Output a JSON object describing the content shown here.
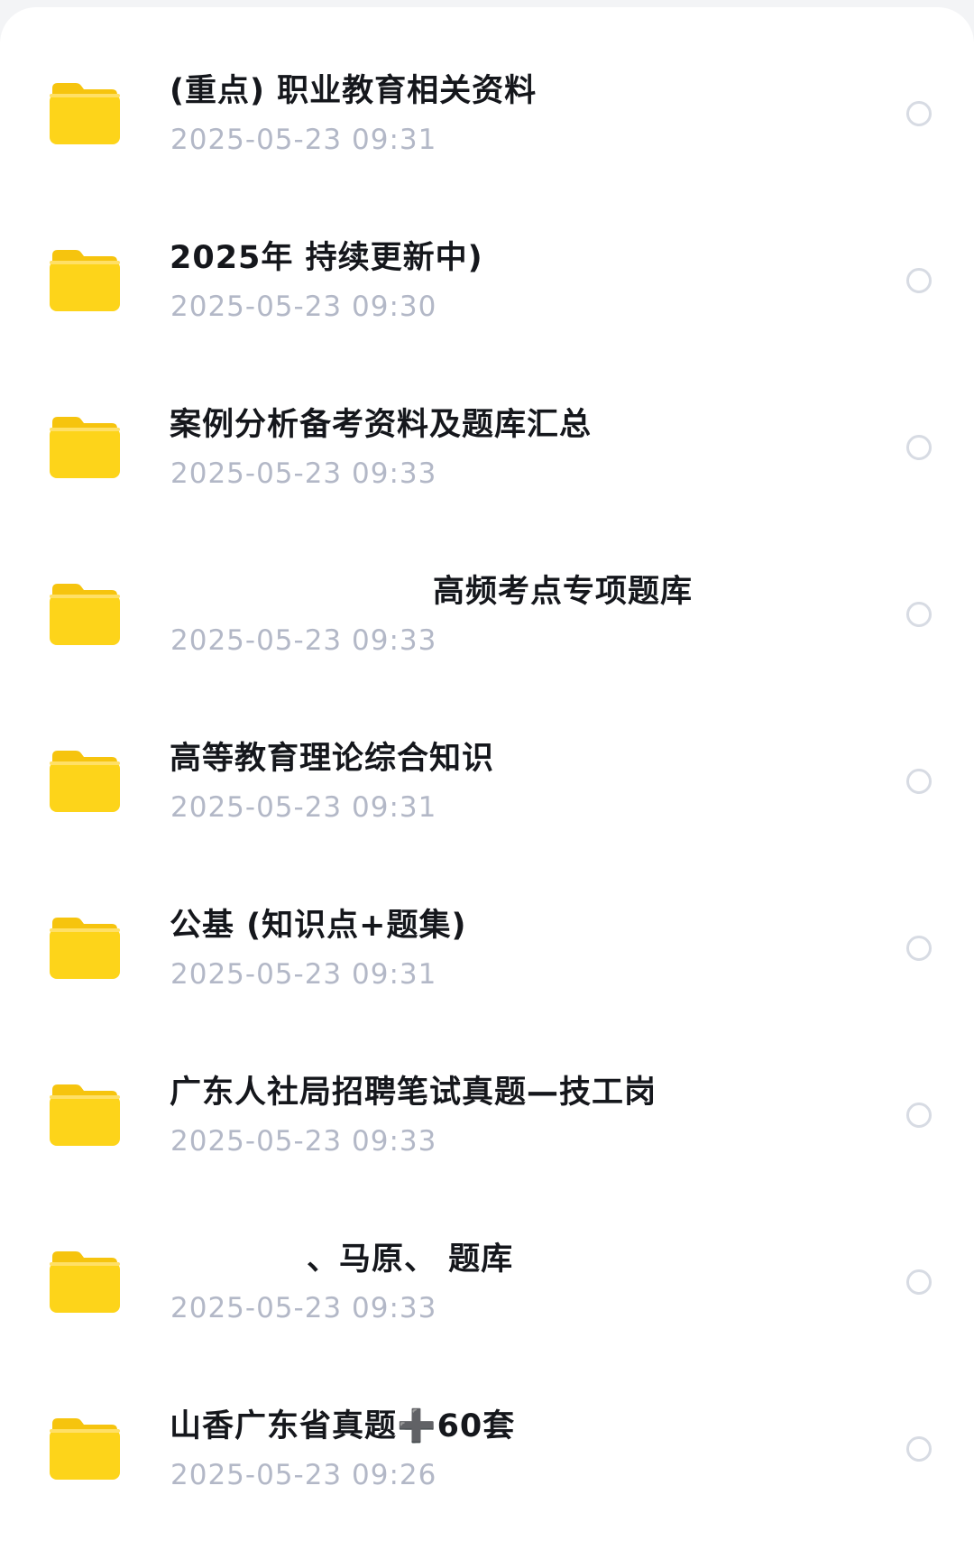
{
  "file_list": {
    "items": [
      {
        "name": "(重点) 职业教育相关资料",
        "date": "2025-05-23 09:31",
        "icon": "folder-icon"
      },
      {
        "name": "2025年 持续更新中)",
        "date": "2025-05-23 09:30",
        "icon": "folder-icon"
      },
      {
        "name": "案例分析备考资料及题库汇总",
        "date": "2025-05-23 09:33",
        "icon": "folder-icon"
      },
      {
        "name": "高频考点专项题库",
        "date": "2025-05-23 09:33",
        "icon": "folder-icon"
      },
      {
        "name": "高等教育理论综合知识",
        "date": "2025-05-23 09:31",
        "icon": "folder-icon"
      },
      {
        "name": "公基 (知识点+题集)",
        "date": "2025-05-23 09:31",
        "icon": "folder-icon"
      },
      {
        "name": "广东人社局招聘笔试真题—技工岗",
        "date": "2025-05-23 09:33",
        "icon": "folder-icon"
      },
      {
        "name": "、马原、 题库",
        "date": "2025-05-23 09:33",
        "icon": "folder-icon"
      },
      {
        "name": "山香广东省真题➕60套",
        "date": "2025-05-23 09:26",
        "icon": "folder-icon"
      }
    ]
  },
  "colors": {
    "folder_fill": "#fdd41a",
    "folder_tab": "#f6c40e",
    "title_text": "#15171c",
    "date_text": "#b3b8c7",
    "radio_border": "#d7dbe3"
  }
}
